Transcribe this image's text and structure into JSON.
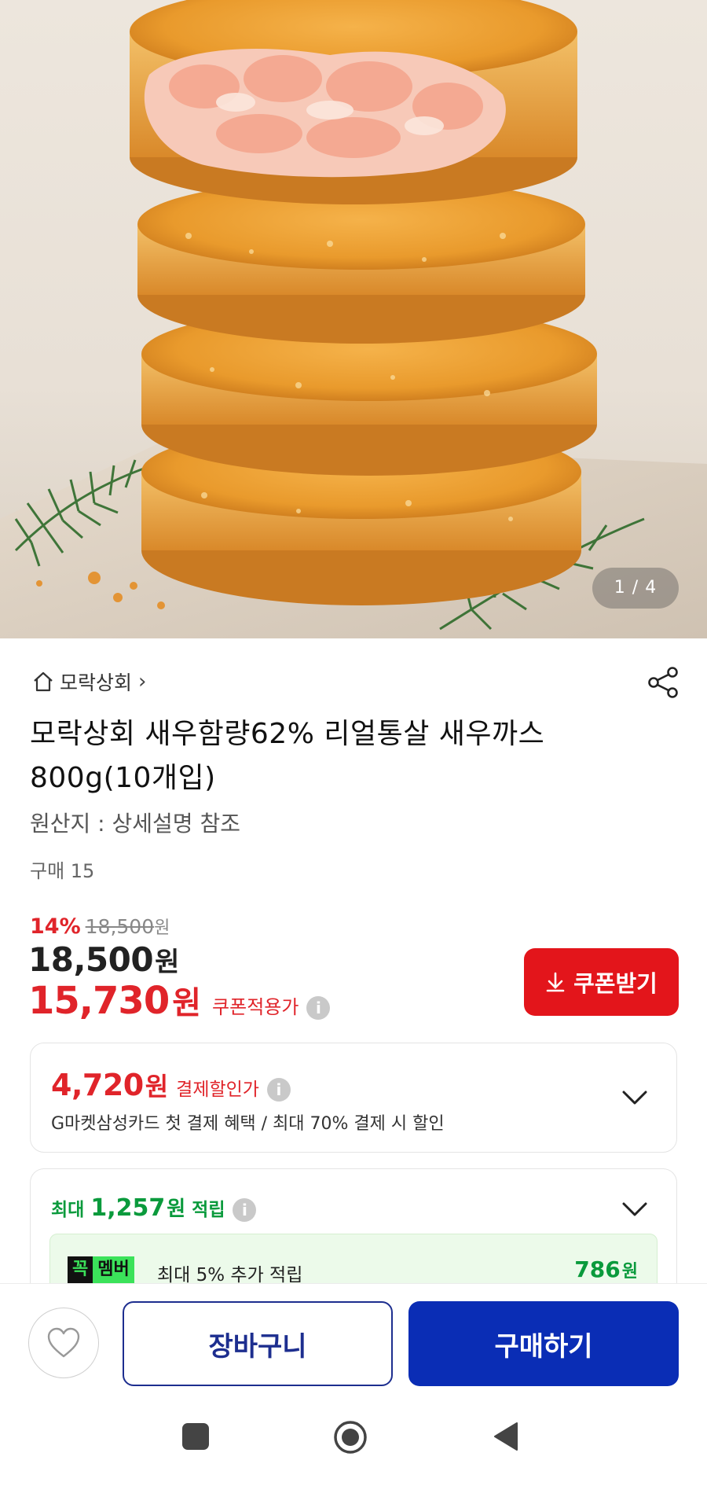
{
  "hero": {
    "image_alt": "",
    "counter": "1 / 4"
  },
  "store": {
    "name": "모락상회",
    "chevron": "›",
    "icon": "home-icon"
  },
  "share": {
    "icon": "share-icon"
  },
  "product": {
    "title": "모락상회 새우함량62% 리얼통살 새우까스 800g(10개입)",
    "origin": "원산지 : 상세설명 참조",
    "purchase_count": "구매 15"
  },
  "pricing": {
    "discount_pct": "14%",
    "original_price": "18,500",
    "original_won": "원",
    "price": "18,500",
    "price_won": "원",
    "coupon_price": "15,730",
    "coupon_won": "원",
    "coupon_label": "쿠폰적용가",
    "info_icon": "i"
  },
  "coupon_button": {
    "label": "쿠폰받기",
    "icon": "download-icon"
  },
  "payment": {
    "price": "4,720",
    "won": "원",
    "label": "결제할인가",
    "info_icon": "i",
    "description": "G마켓삼성카드 첫 결제 혜택 / 최대 70% 결제 시 할인"
  },
  "points": {
    "prefix": "최대",
    "value": "1,257",
    "won": "원",
    "label": "적립",
    "info_icon": "i",
    "member": {
      "badge_left": "꼭",
      "badge_right": "멤버",
      "text": "최대 5% 추가 적립",
      "value": "786",
      "won": "원"
    }
  },
  "actions": {
    "wishlist_icon": "heart-icon",
    "cart": "장바구니",
    "buy": "구매하기"
  },
  "colors": {
    "accent_red": "#e3151b",
    "brand_blue": "#0a2db5",
    "green": "#0a9a3c"
  }
}
